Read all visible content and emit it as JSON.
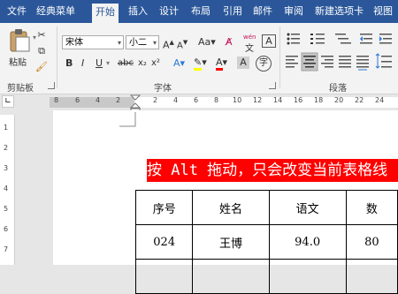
{
  "tabs": [
    "文件",
    "经典菜单",
    "开始",
    "插入",
    "设计",
    "布局",
    "引用",
    "邮件",
    "审阅",
    "新建选项卡",
    "视图"
  ],
  "clipboard": {
    "paste_label": "粘贴",
    "group_label": "剪贴板"
  },
  "font": {
    "name": "宋体",
    "size": "小二",
    "group_label": "字体",
    "phonetic_top": "wén",
    "phonetic_bottom": "文"
  },
  "paragraph": {
    "group_label": "段落"
  },
  "ruler": {
    "h_ticks": [
      "8",
      "6",
      "4",
      "2",
      "2",
      "4",
      "6",
      "8",
      "10",
      "12",
      "14",
      "16",
      "18",
      "20",
      "22",
      "24"
    ],
    "v_ticks": [
      "1",
      "2",
      "3",
      "4",
      "5",
      "6",
      "7"
    ]
  },
  "document": {
    "banner": "按 Alt 拖动，只会改变当前表格线",
    "headers": [
      "序号",
      "姓名",
      "语文",
      "数"
    ],
    "rows": [
      [
        "024",
        "王博",
        "94.0",
        "80"
      ]
    ]
  },
  "colors": {
    "tab_bar": "#2b579a",
    "banner_bg": "#ff0000",
    "font_color": "#ff0000",
    "highlight": "#ffff00"
  }
}
